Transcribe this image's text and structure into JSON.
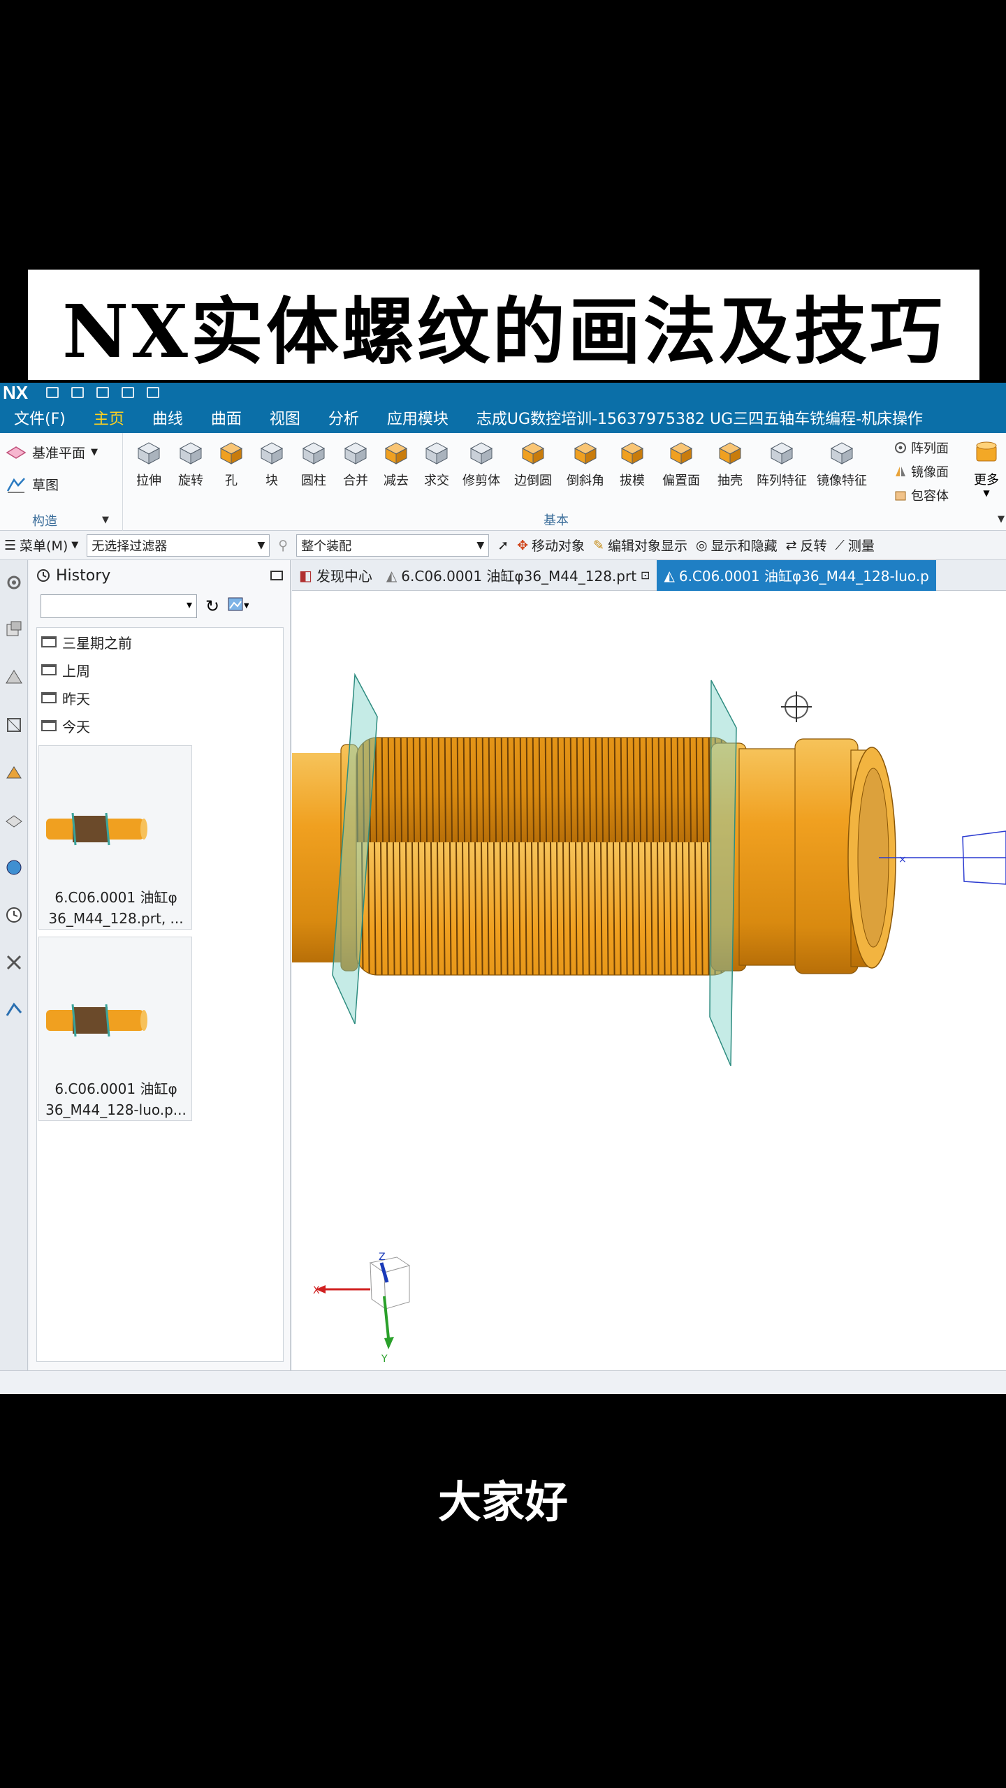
{
  "banner": {
    "title": "NX实体螺纹的画法及技巧"
  },
  "app": {
    "logo": "NX"
  },
  "menubar": {
    "items": [
      "文件(F)",
      "主页",
      "曲线",
      "曲面",
      "视图",
      "分析",
      "应用模块"
    ],
    "active": "主页",
    "window_title": "志成UG数控培训-15637975382  UG三四五轴车铣编程-机床操作"
  },
  "ribbon": {
    "left": {
      "datum_plane": "基准平面",
      "sketch": "草图",
      "group": "构造"
    },
    "tools": [
      "拉伸",
      "旋转",
      "孔",
      "块",
      "圆柱",
      "合并",
      "减去",
      "求交",
      "修剪体",
      "边倒圆",
      "倒斜角",
      "拔模",
      "偏置面",
      "抽壳",
      "阵列特征",
      "镜像特征"
    ],
    "right": [
      "阵列面",
      "镜像面",
      "包容体"
    ],
    "more": "更多",
    "group": "基本"
  },
  "selbar": {
    "menu": "菜单(M)",
    "filter": "无选择过滤器",
    "scope": "整个装配",
    "tools": [
      "移动对象",
      "编辑对象显示",
      "显示和隐藏",
      "反转",
      "测量"
    ]
  },
  "history": {
    "title": "History",
    "folders": [
      "三星期之前",
      "上周",
      "昨天",
      "今天"
    ],
    "items": [
      {
        "line1": "6.C06.0001  油缸φ",
        "line2": "36_M44_128.prt, ..."
      },
      {
        "line1": "6.C06.0001  油缸φ",
        "line2": "36_M44_128-luo.p..."
      }
    ]
  },
  "tabs": [
    {
      "label": "发现中心"
    },
    {
      "label": "6.C06.0001  油缸φ36_M44_128.prt"
    },
    {
      "label": "6.C06.0001  油缸φ36_M44_128-luo.p"
    }
  ],
  "triad": {
    "x": "X",
    "y": "Y",
    "z": "Z"
  },
  "colors": {
    "accent": "#0b6fa8",
    "active_menu": "#ffd21f",
    "part": "#f0a020",
    "plane": "#7fd3c8"
  },
  "subtitle": "大家好"
}
